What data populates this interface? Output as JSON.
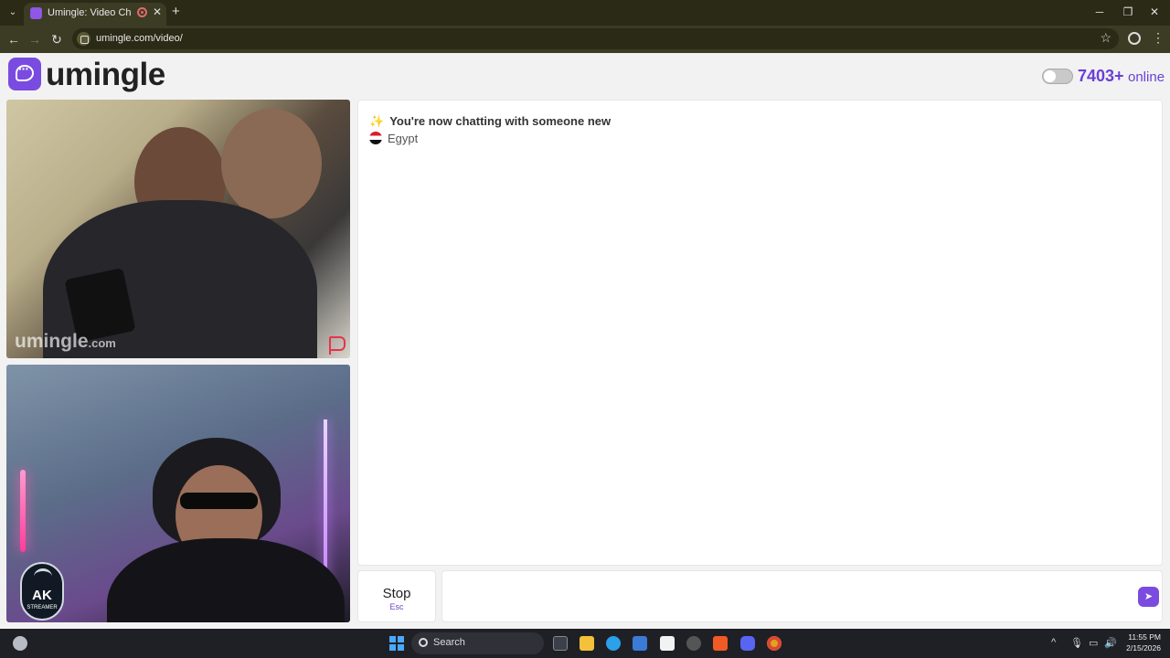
{
  "browser": {
    "tab_title": "Umingle: Video Chat with Strangers",
    "url": "umingle.com/video/",
    "new_tab_label": "+",
    "icons": [
      "tab-search-icon",
      "record-icon",
      "close-icon",
      "back-icon",
      "forward-icon",
      "reload-icon",
      "star-icon",
      "profile-icon",
      "menu-icon"
    ]
  },
  "header": {
    "logo_text": "umingle",
    "online_count": "7403+",
    "online_label": "online",
    "brand_color": "#7a4be0"
  },
  "video": {
    "stranger_watermark": "umingle",
    "stranger_watermark_suffix": ".com",
    "self_badge": "AK",
    "self_badge_sub": "STREAMER"
  },
  "chat": {
    "messages": [
      {
        "icon": "sparkle-icon",
        "text": "You're now chatting with someone new"
      },
      {
        "icon": "egypt-flag-icon",
        "text": "Egypt"
      }
    ],
    "input_value": "",
    "input_placeholder": ""
  },
  "controls": {
    "stop_label": "Stop",
    "stop_shortcut": "Esc",
    "send_icon": "send-icon"
  },
  "taskbar": {
    "search_label": "Search",
    "time": "11:55 PM",
    "date": "2/15/2026"
  }
}
